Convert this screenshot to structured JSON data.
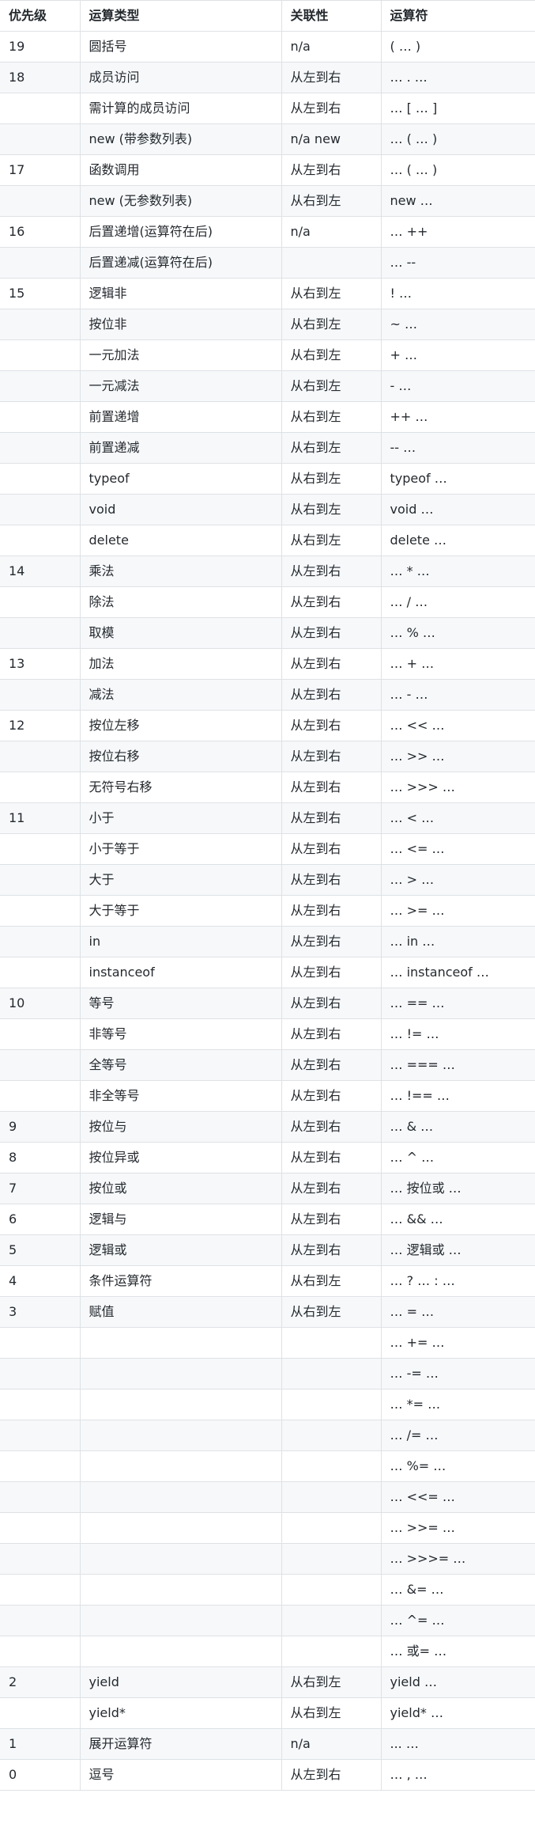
{
  "table": {
    "headers": [
      "优先级",
      "运算类型",
      "关联性",
      "运算符"
    ],
    "rows": [
      [
        "19",
        "圆括号",
        "n/a",
        "( … )"
      ],
      [
        "18",
        "成员访问",
        "从左到右",
        "… . …"
      ],
      [
        "",
        "需计算的成员访问",
        "从左到右",
        "… [ … ]"
      ],
      [
        "",
        "new (带参数列表)",
        "n/a new",
        "… ( … )"
      ],
      [
        "17",
        "函数调用",
        "从左到右",
        "… ( … )"
      ],
      [
        "",
        "new (无参数列表)",
        "从右到左",
        "new …"
      ],
      [
        "16",
        "后置递增(运算符在后)",
        "n/a",
        "… ++"
      ],
      [
        "",
        "后置递减(运算符在后)",
        "",
        "… --"
      ],
      [
        "15",
        "逻辑非",
        "从右到左",
        "! …"
      ],
      [
        "",
        "按位非",
        "从右到左",
        "~ …"
      ],
      [
        "",
        "一元加法",
        "从右到左",
        "+ …"
      ],
      [
        "",
        "一元减法",
        "从右到左",
        "- …"
      ],
      [
        "",
        "前置递增",
        "从右到左",
        "++ …"
      ],
      [
        "",
        "前置递减",
        "从右到左",
        "-- …"
      ],
      [
        "",
        "typeof",
        "从右到左",
        "typeof …"
      ],
      [
        "",
        "void",
        "从右到左",
        "void …"
      ],
      [
        "",
        "delete",
        "从右到左",
        "delete …"
      ],
      [
        "14",
        "乘法",
        "从左到右",
        "… * …"
      ],
      [
        "",
        "除法",
        "从左到右",
        "… / …"
      ],
      [
        "",
        "取模",
        "从左到右",
        "… % …"
      ],
      [
        "13",
        "加法",
        "从左到右",
        "… + …"
      ],
      [
        "",
        "减法",
        "从左到右",
        "… - …"
      ],
      [
        "12",
        "按位左移",
        "从左到右",
        "… << …"
      ],
      [
        "",
        "按位右移",
        "从左到右",
        "… >> …"
      ],
      [
        "",
        "无符号右移",
        "从左到右",
        "… >>> …"
      ],
      [
        "11",
        "小于",
        "从左到右",
        "… < …"
      ],
      [
        "",
        "小于等于",
        "从左到右",
        "… <= …"
      ],
      [
        "",
        "大于",
        "从左到右",
        "… > …"
      ],
      [
        "",
        "大于等于",
        "从左到右",
        "… >= …"
      ],
      [
        "",
        "in",
        "从左到右",
        "… in …"
      ],
      [
        "",
        "instanceof",
        "从左到右",
        "… instanceof …"
      ],
      [
        "10",
        "等号",
        "从左到右",
        "… == …"
      ],
      [
        "",
        "非等号",
        "从左到右",
        "… != …"
      ],
      [
        "",
        "全等号",
        "从左到右",
        "… === …"
      ],
      [
        "",
        "非全等号",
        "从左到右",
        "… !== …"
      ],
      [
        "9",
        "按位与",
        "从左到右",
        "… & …"
      ],
      [
        "8",
        "按位异或",
        "从左到右",
        "… ^ …"
      ],
      [
        "7",
        "按位或",
        "从左到右",
        "… 按位或 …"
      ],
      [
        "6",
        "逻辑与",
        "从左到右",
        "… && …"
      ],
      [
        "5",
        "逻辑或",
        "从左到右",
        "… 逻辑或 …"
      ],
      [
        "4",
        "条件运算符",
        "从右到左",
        "… ? … : …"
      ],
      [
        "3",
        "赋值",
        "从右到左",
        "… = …"
      ],
      [
        "",
        "",
        "",
        "… += …"
      ],
      [
        "",
        "",
        "",
        "… -= …"
      ],
      [
        "",
        "",
        "",
        "… *= …"
      ],
      [
        "",
        "",
        "",
        "… /= …"
      ],
      [
        "",
        "",
        "",
        "… %= …"
      ],
      [
        "",
        "",
        "",
        "… <<= …"
      ],
      [
        "",
        "",
        "",
        "… >>= …"
      ],
      [
        "",
        "",
        "",
        "… >>>= …"
      ],
      [
        "",
        "",
        "",
        "… &= …"
      ],
      [
        "",
        "",
        "",
        "… ^= …"
      ],
      [
        "",
        "",
        "",
        "… 或= …"
      ],
      [
        "2",
        "yield",
        "从右到左",
        "yield …"
      ],
      [
        "",
        "yield*",
        "从右到左",
        "yield* …"
      ],
      [
        "1",
        "展开运算符",
        "n/a",
        "... …"
      ],
      [
        "0",
        "逗号",
        "从左到右",
        "… , …"
      ]
    ]
  }
}
